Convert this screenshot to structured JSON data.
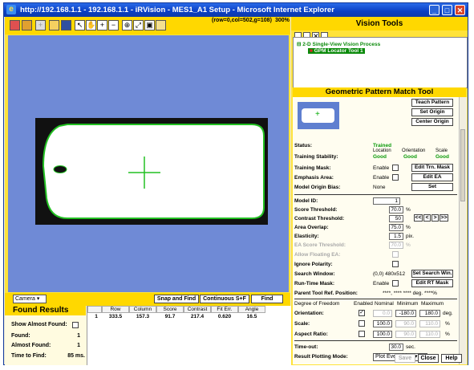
{
  "window": {
    "title": "http://192.168.1.1 - 192.168.1.1 - iRVision - MES1_A1 Setup - Microsoft Internet Explorer"
  },
  "image_view": {
    "coords": "(row=0,col=502,g=108)",
    "zoom": "300%"
  },
  "controls": {
    "camera_select": "Camera",
    "snap_find": "Snap and Find",
    "continuous": "Continuous S+F",
    "find": "Find"
  },
  "found_results": {
    "title": "Found Results",
    "show_almost_found_label": "Show Almost Found:",
    "found_label": "Found:",
    "found_value": "1",
    "almost_found_label": "Almost Found:",
    "almost_found_value": "1",
    "time_label": "Time to Find:",
    "time_value": "85 ms.",
    "columns": [
      "Row",
      "Column",
      "Score",
      "Contrast",
      "Fit Err.",
      "Angle"
    ],
    "rows": [
      [
        "1",
        "333.5",
        "157.3",
        "91.7",
        "217.4",
        "0.620",
        "16.5"
      ]
    ]
  },
  "vision_tools": {
    "title": "Vision Tools",
    "tree": [
      "2-D Single-View Vision Process",
      "GPM Locator Tool 1"
    ]
  },
  "gpm": {
    "title": "Geometric Pattern Match Tool",
    "teach_pattern": "Teach Pattern",
    "set_origin": "Set Origin",
    "center_origin": "Center Origin",
    "status_label": "Status:",
    "status_value": "Trained",
    "stability_label": "Training Stability:",
    "location_hdr": "Location",
    "location_val": "Good",
    "orientation_hdr": "Orientation",
    "orientation_val": "Good",
    "scale_hdr": "Scale",
    "scale_val": "Good",
    "mask_label": "Training Mask:",
    "mask_enable": "Enable",
    "edit_trn_mask": "Edit Trn. Mask",
    "emph_label": "Emphasis Area:",
    "emph_enable": "Enable",
    "edit_ea": "Edit EA",
    "origin_bias_label": "Model Origin Bias:",
    "origin_bias_value": "None",
    "set": "Set",
    "model_id_label": "Model ID:",
    "model_id": "1",
    "score_label": "Score Threshold:",
    "score": "70.0",
    "score_unit": "%",
    "contrast_label": "Contrast Threshold:",
    "contrast": "50",
    "overlap_label": "Area Overlap:",
    "overlap": "75.0",
    "overlap_unit": "%",
    "elasticity_label": "Elasticity:",
    "elasticity": "1.5",
    "elasticity_unit": "pix.",
    "ea_score_label": "EA Score Threshold:",
    "ea_score": "70.0",
    "ea_score_unit": "%",
    "allow_float_label": "Allow Floating EA:",
    "ignore_pol_label": "Ignore Polarity:",
    "search_window_label": "Search Window:",
    "search_window_value": "(0,0) 480x512",
    "set_search_win": "Set Search Win.",
    "runtime_mask_label": "Run-Time Mask:",
    "runtime_mask_enable": "Enable",
    "edit_rt_mask": "Edit RT Mask",
    "parent_label": "Parent Tool Ref. Position:",
    "parent_value": "****,  ****  ****  deg.  ****%",
    "dof_hdr": "Degree of Freedom",
    "enabled_hdr": "Enabled",
    "nominal_hdr": "Nominal",
    "minimum_hdr": "Minimum",
    "maximum_hdr": "Maximum",
    "orientation_label": "Orientation:",
    "ori_nom": "0.0",
    "ori_min": "-180.0",
    "ori_max": "180.0",
    "ori_unit": "deg.",
    "scale_label": "Scale:",
    "sc_nom": "100.0",
    "sc_min": "90.0",
    "sc_max": "110.0",
    "sc_unit": "%",
    "aspect_label": "Aspect Ratio:",
    "ar_nom": "100.0",
    "ar_min": "90.0",
    "ar_max": "110.0",
    "ar_unit": "%",
    "timeout_label": "Time-out:",
    "timeout": "30.0",
    "timeout_unit": "sec.",
    "plot_label": "Result Plotting Mode:",
    "plot_value": "Plot Everything",
    "save": "Save",
    "close": "Close",
    "help": "Help"
  }
}
